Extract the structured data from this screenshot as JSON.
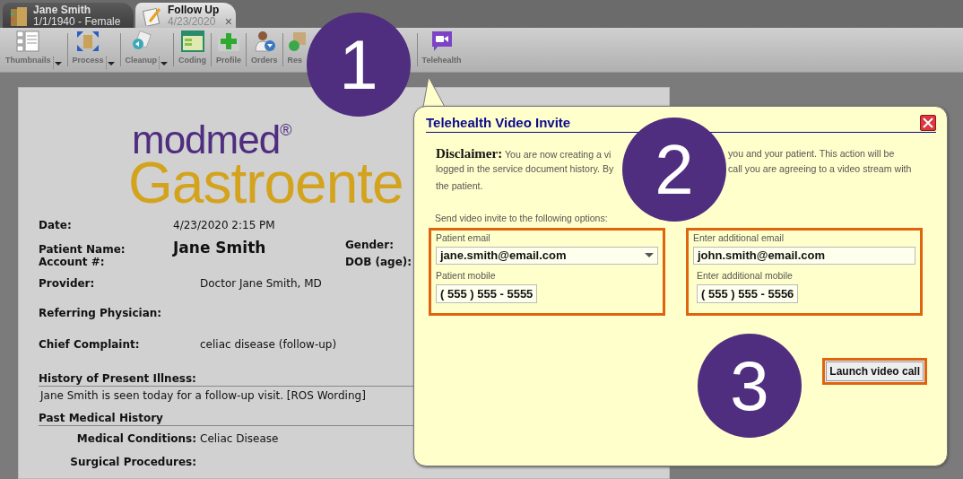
{
  "tabs": [
    {
      "title": "Jane Smith",
      "subtitle": "1/1/1940 - Female",
      "selected": false
    },
    {
      "title": "Follow Up",
      "subtitle": "4/23/2020",
      "selected": true,
      "close": "×"
    }
  ],
  "toolbar": [
    {
      "label": "Thumbnails",
      "kind": "thumbnails",
      "dropdown": true
    },
    {
      "label": "Process",
      "kind": "process",
      "dropdown": true
    },
    {
      "label": "Cleanup",
      "kind": "cleanup",
      "dropdown": true
    },
    {
      "label": "Coding",
      "kind": "coding"
    },
    {
      "label": "Profile",
      "kind": "profile"
    },
    {
      "label": "Orders",
      "kind": "orders"
    },
    {
      "label": "Res",
      "kind": "results"
    },
    {
      "label": "Telehealth",
      "kind": "telehealth"
    }
  ],
  "document": {
    "logo_top": "modmed",
    "logo_mark": "®",
    "logo_bottom": "Gastroente",
    "fields": [
      {
        "kind": "near",
        "label": "Date:",
        "value": "4/23/2020 2:15 PM"
      },
      {
        "kind": "near",
        "label": "Patient Name:",
        "value": "Jane Smith",
        "emphasis": true,
        "side_label": "Gender:"
      },
      {
        "kind": "near",
        "label": "Account #:",
        "side_label": "DOB (age):"
      },
      {
        "kind": "far",
        "label": "Provider:",
        "value": "Doctor Jane Smith, MD"
      },
      {
        "kind": "far",
        "label": "Referring Physician:"
      },
      {
        "kind": "far",
        "label": "Chief Complaint:",
        "value": "celiac disease (follow-up)"
      }
    ],
    "sections": [
      {
        "heading": "History of Present Illness:",
        "body": "Jane Smith is seen today for a follow-up visit.  [ROS Wording]"
      },
      {
        "heading": "Past Medical History",
        "items": [
          {
            "label": "Medical Conditions:",
            "value": "Celiac Disease"
          },
          {
            "label": "Surgical Procedures:"
          }
        ]
      }
    ]
  },
  "dialog": {
    "title": "Telehealth Video Invite",
    "disclaimer": {
      "label": "Disclaimer:",
      "lines": [
        {
          "left": "You are now creating a vi",
          "right": "you and your patient. This action will be"
        },
        {
          "left": "logged in the service document history. By",
          "right": "call you are agreeing to a video stream with"
        },
        {
          "left": "the patient."
        }
      ]
    },
    "instruction": "Send video invite to the following options:",
    "groups": [
      {
        "email_label": "Patient email",
        "email": "jane.smith@email.com",
        "email_dropdown": true,
        "mobile_label": "Patient mobile",
        "mobile": "( 555 ) 555 - 5555"
      },
      {
        "email_label": "Enter additional email",
        "email": "john.smith@email.com",
        "email_dropdown": false,
        "mobile_label": "Enter additional mobile",
        "mobile": "( 555 ) 555 - 5556"
      }
    ],
    "button": "Launch video call"
  },
  "callouts": [
    "1",
    "2",
    "3"
  ]
}
